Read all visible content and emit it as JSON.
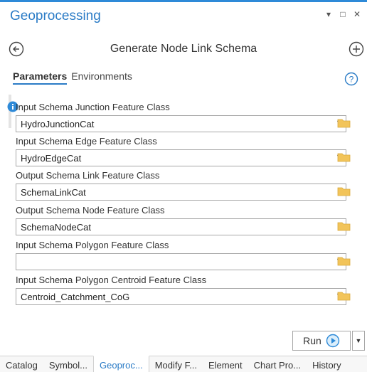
{
  "pane": {
    "title": "Geoprocessing",
    "window_buttons": [
      "▾",
      "□",
      "✕"
    ]
  },
  "tool": {
    "title": "Generate Node Link Schema"
  },
  "tabs": {
    "parameters": "Parameters",
    "environments": "Environments"
  },
  "parameters": [
    {
      "label": "Input Schema Junction Feature Class",
      "value": "HydroJunctionCat",
      "dropdown": true,
      "info": true
    },
    {
      "label": "Input Schema Edge Feature Class",
      "value": "HydroEdgeCat",
      "dropdown": true,
      "info": false
    },
    {
      "label": "Output Schema Link Feature Class",
      "value": "SchemaLinkCat",
      "dropdown": false,
      "info": false
    },
    {
      "label": "Output Schema Node Feature Class",
      "value": "SchemaNodeCat",
      "dropdown": false,
      "info": false
    },
    {
      "label": "Input Schema Polygon Feature Class",
      "value": "",
      "dropdown": true,
      "info": false
    },
    {
      "label": "Input Schema Polygon Centroid Feature Class",
      "value": "Centroid_Catchment_CoG",
      "dropdown": true,
      "info": false
    }
  ],
  "run": {
    "label": "Run"
  },
  "bottom_tabs": [
    "Catalog",
    "Symbol...",
    "Geoproc...",
    "Modify F...",
    "Element",
    "Chart Pro...",
    "History"
  ],
  "active_bottom_tab": "Geoproc...",
  "colors": {
    "accent": "#2a7bc6",
    "folder": "#f2c45a",
    "info": "#2e8ad8"
  }
}
